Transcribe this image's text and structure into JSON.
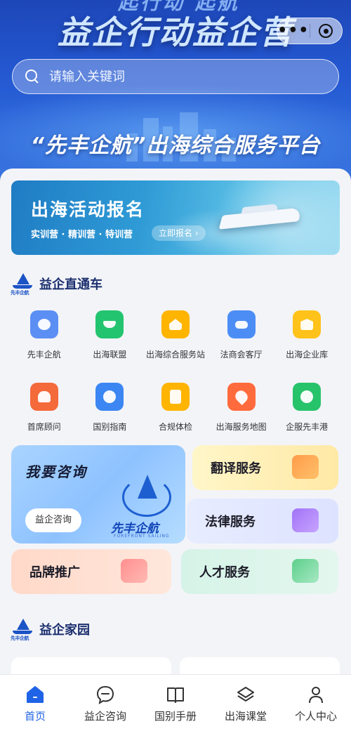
{
  "header": {
    "slogan_top": "起行动 起航",
    "slogan": "益企行动益企营",
    "platform_title": "“先丰企航”出海综合服务平台",
    "capsule_more": "•••"
  },
  "search": {
    "placeholder": "请输入关键词"
  },
  "banner": {
    "title": "出海活动报名",
    "subtitle": "实训营 · 精训营 · 特训营",
    "cta": "立即报名 ›"
  },
  "sections": {
    "direct": {
      "title": "益企直通车",
      "logo_text": "先丰企航"
    },
    "home": {
      "title": "益企家园",
      "logo_text": "先丰企航"
    }
  },
  "grid": [
    {
      "label": "先丰企航",
      "icon": "ship-logo-icon",
      "color": "#5b8ff4"
    },
    {
      "label": "出海联盟",
      "icon": "cargo-ship-icon",
      "color": "#23c46f"
    },
    {
      "label": "出海综合服务站",
      "icon": "home-icon",
      "color": "#ffb400"
    },
    {
      "label": "法商会客厅",
      "icon": "sofa-icon",
      "color": "#4c8df5"
    },
    {
      "label": "出海企业库",
      "icon": "crown-box-icon",
      "color": "#ffc21a"
    },
    {
      "label": "首席顾问",
      "icon": "advisor-icon",
      "color": "#f46a3a"
    },
    {
      "label": "国别指南",
      "icon": "compass-icon",
      "color": "#3b86f2"
    },
    {
      "label": "合规体检",
      "icon": "checklist-icon",
      "color": "#ffb400"
    },
    {
      "label": "出海服务地图",
      "icon": "map-pin-icon",
      "color": "#ff6b3d"
    },
    {
      "label": "企服先丰港",
      "icon": "enterprise-icon",
      "color": "#27c36a"
    }
  ],
  "cards": {
    "consult": {
      "title": "我要咨询",
      "button": "益企咨询",
      "logo_name": "先丰企航",
      "logo_en": "FOREFRONT SAILING"
    },
    "translate": "翻译服务",
    "legal": "法律服务",
    "brand": "品牌推广",
    "talent": "人才服务"
  },
  "tabs": [
    {
      "label": "首页",
      "icon": "home-icon",
      "active": true
    },
    {
      "label": "益企咨询",
      "icon": "chat-bubble-icon",
      "active": false
    },
    {
      "label": "国别手册",
      "icon": "book-icon",
      "active": false
    },
    {
      "label": "出海课堂",
      "icon": "layers-icon",
      "active": false
    },
    {
      "label": "个人中心",
      "icon": "user-icon",
      "active": false
    }
  ],
  "colors": {
    "accent": "#1f63e6",
    "hero": "#2356cf",
    "section_title": "#1b2f6e"
  }
}
